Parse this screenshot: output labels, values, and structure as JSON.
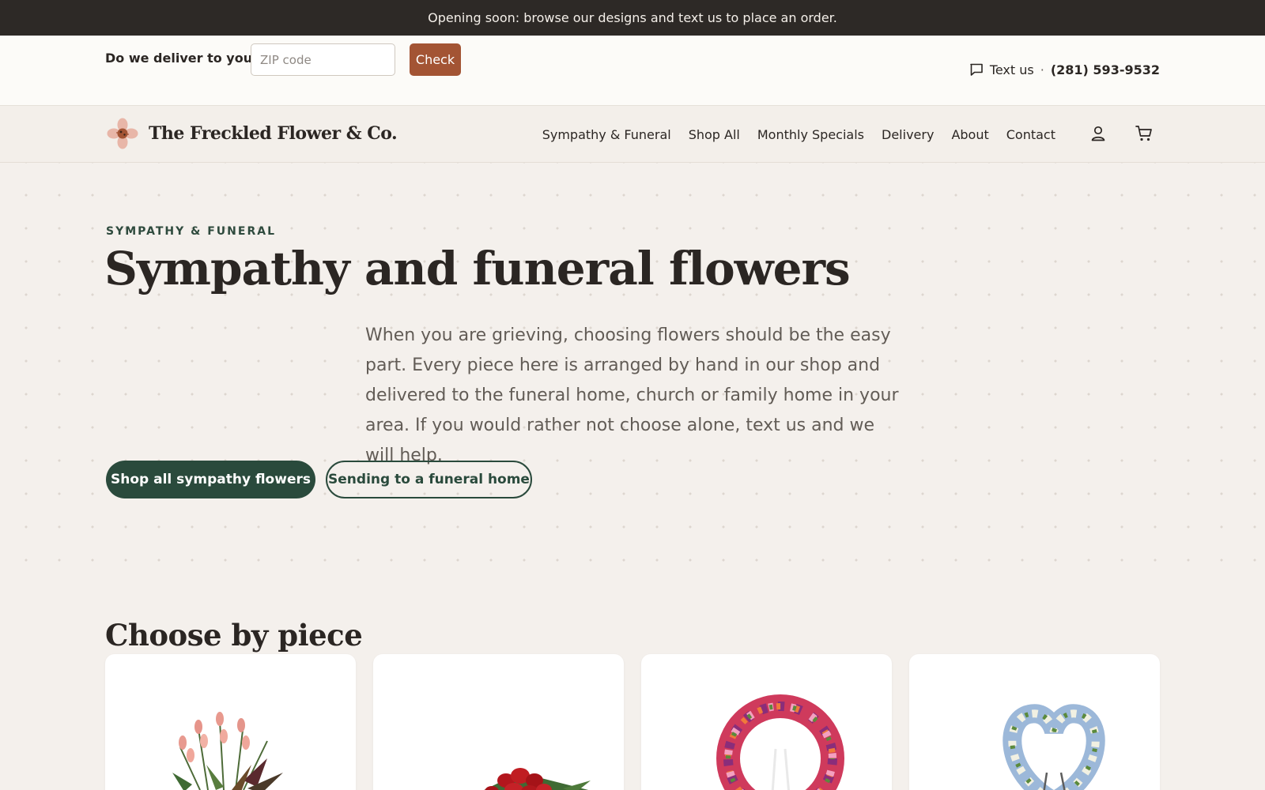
{
  "announcement": {
    "text": "Opening soon: browse our designs and text us to place an order."
  },
  "utility": {
    "deliver_label": "Do we deliver to you?",
    "zip_placeholder": "ZIP code",
    "check_label": "Check",
    "text_us": "Text us",
    "separator": "·",
    "phone": "(281) 593-9532"
  },
  "brand": {
    "name": "The Freckled Flower & Co."
  },
  "nav": {
    "items": [
      {
        "label": "Sympathy & Funeral"
      },
      {
        "label": "Shop All"
      },
      {
        "label": "Monthly Specials"
      },
      {
        "label": "Delivery"
      },
      {
        "label": "About"
      },
      {
        "label": "Contact"
      }
    ]
  },
  "hero": {
    "eyebrow": "SYMPATHY & FUNERAL",
    "title": "Sympathy and funeral flowers",
    "body": "When you are grieving, choosing flowers should be the easy part. Every piece here is arranged by hand in our shop and delivered to the funeral home, church or family home in your area. If you would rather not choose alone, text us and we will help.",
    "primary_button": "Shop all sympathy flowers",
    "secondary_button": "Sending to a funeral home"
  },
  "choose": {
    "title": "Choose by piece"
  },
  "colors": {
    "announcement_bg": "#2d2926",
    "accent_terracotta": "#a35434",
    "accent_green": "#2a4a3c",
    "page_bg": "#f4f0ec"
  },
  "icons": [
    "chat-icon",
    "flower-logo-icon",
    "account-icon",
    "cart-icon"
  ]
}
